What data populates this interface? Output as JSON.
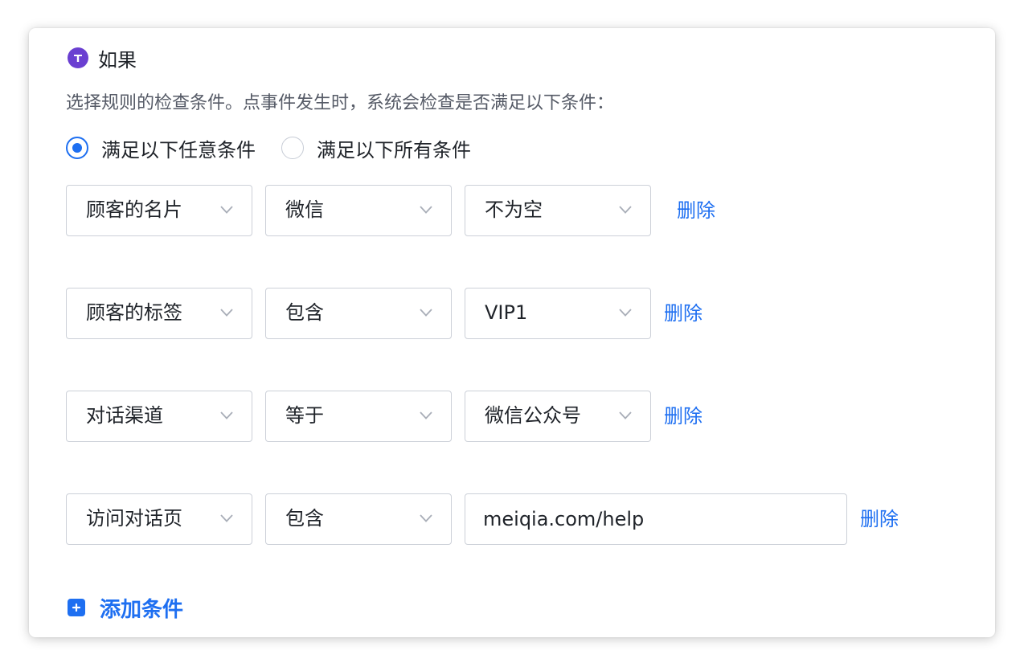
{
  "section": {
    "title": "如果",
    "description": "选择规则的检查条件。点事件发生时，系统会检查是否满足以下条件："
  },
  "match_mode": {
    "options": [
      {
        "label": "满足以下任意条件",
        "selected": true
      },
      {
        "label": "满足以下所有条件",
        "selected": false
      }
    ]
  },
  "conditions": [
    {
      "field": "顾客的名片",
      "operator": "微信",
      "value": "不为空",
      "delete_label": "删除"
    },
    {
      "field": "顾客的标签",
      "operator": "包含",
      "value": "VIP1",
      "delete_label": "删除"
    },
    {
      "field": "对话渠道",
      "operator": "等于",
      "value": "微信公众号",
      "delete_label": "删除"
    },
    {
      "field": "访问对话页",
      "operator": "包含",
      "value": "meiqia.com/help",
      "delete_label": "删除"
    }
  ],
  "add_condition_label": "添加条件",
  "colors": {
    "accent": "#1e6ff1",
    "icon_purple": "#6a3fd1",
    "border": "#ccd0d8",
    "text": "#1f2329",
    "muted_text": "#555a66"
  },
  "icons": {
    "header": "t-circle-icon",
    "dropdown": "chevron-down-icon",
    "add": "plus-square-icon"
  }
}
